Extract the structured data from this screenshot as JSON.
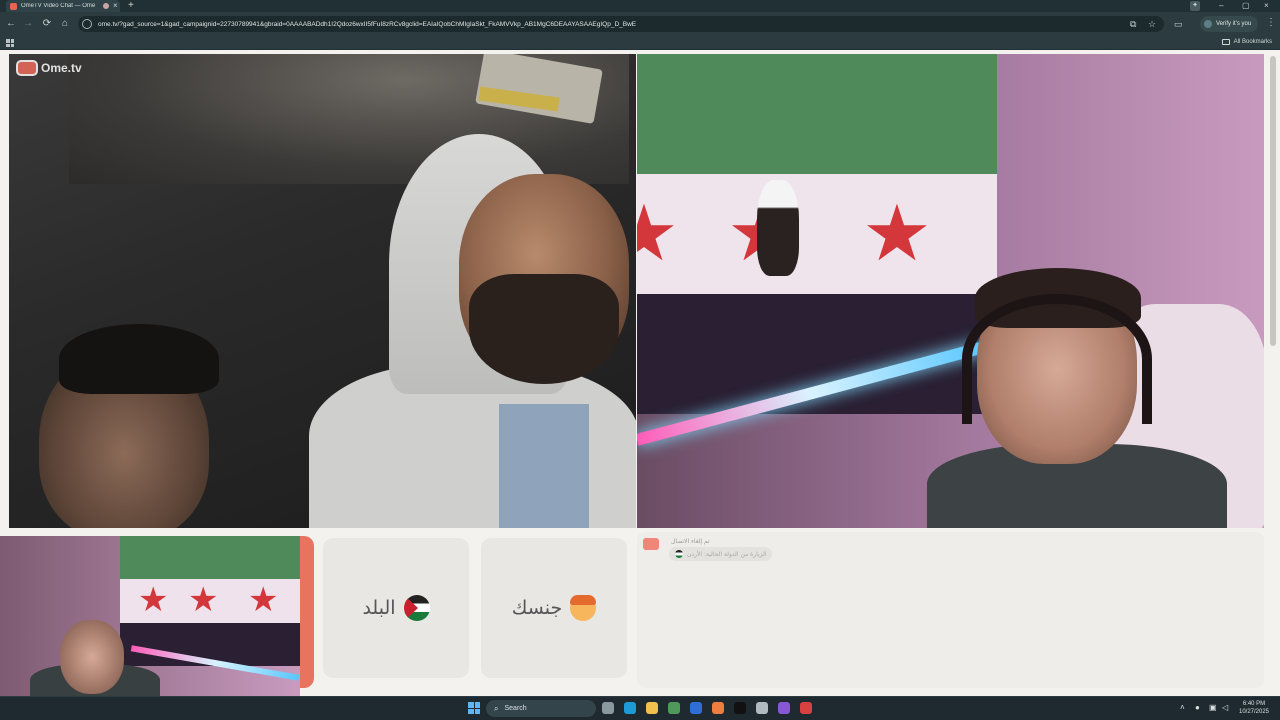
{
  "browser": {
    "tab_title": "OmeTV Video Chat — Ome",
    "tab_close": "×",
    "new_tab": "+",
    "window_controls": [
      "–",
      "▢",
      "×"
    ],
    "url": "ome.tv/?gad_source=1&gad_campaignid=22730789941&gbraid=0AAAABADdh1I2Qdoz6wxII5fFuI8zRCv8gclid=EAIaIQobChMIgIaSkt_FkAMVVkp_AB1MgC6DEAAYASAAEgIQp_D_BwE",
    "verify_label": "Verify it's you",
    "all_bookmarks": "All Bookmarks",
    "nav_icons": [
      "←",
      "→",
      "⟳",
      "⌂"
    ]
  },
  "app": {
    "logo_text": "Ome.tv"
  },
  "filters": {
    "country_label": "البلد",
    "gender_label": "جنسك"
  },
  "chat": {
    "message": "تم إلغاء الاتصال",
    "sub_message": "الزيارة من الدولة الحالية: الأردن"
  },
  "taskbar": {
    "search_placeholder": "Search",
    "time": "6:40 PM",
    "date": "10/27/2025",
    "app_colors": [
      "#8a98a0",
      "#1e9bd6",
      "#f2c04d",
      "#4f9a5b",
      "#2d6fd6",
      "#ef7d40",
      "#111111",
      "#b0b8c0",
      "#8757d6",
      "#d94040"
    ]
  },
  "colors": {
    "accent": "#ef6c5a",
    "page_bg": "#f4f2ef"
  }
}
